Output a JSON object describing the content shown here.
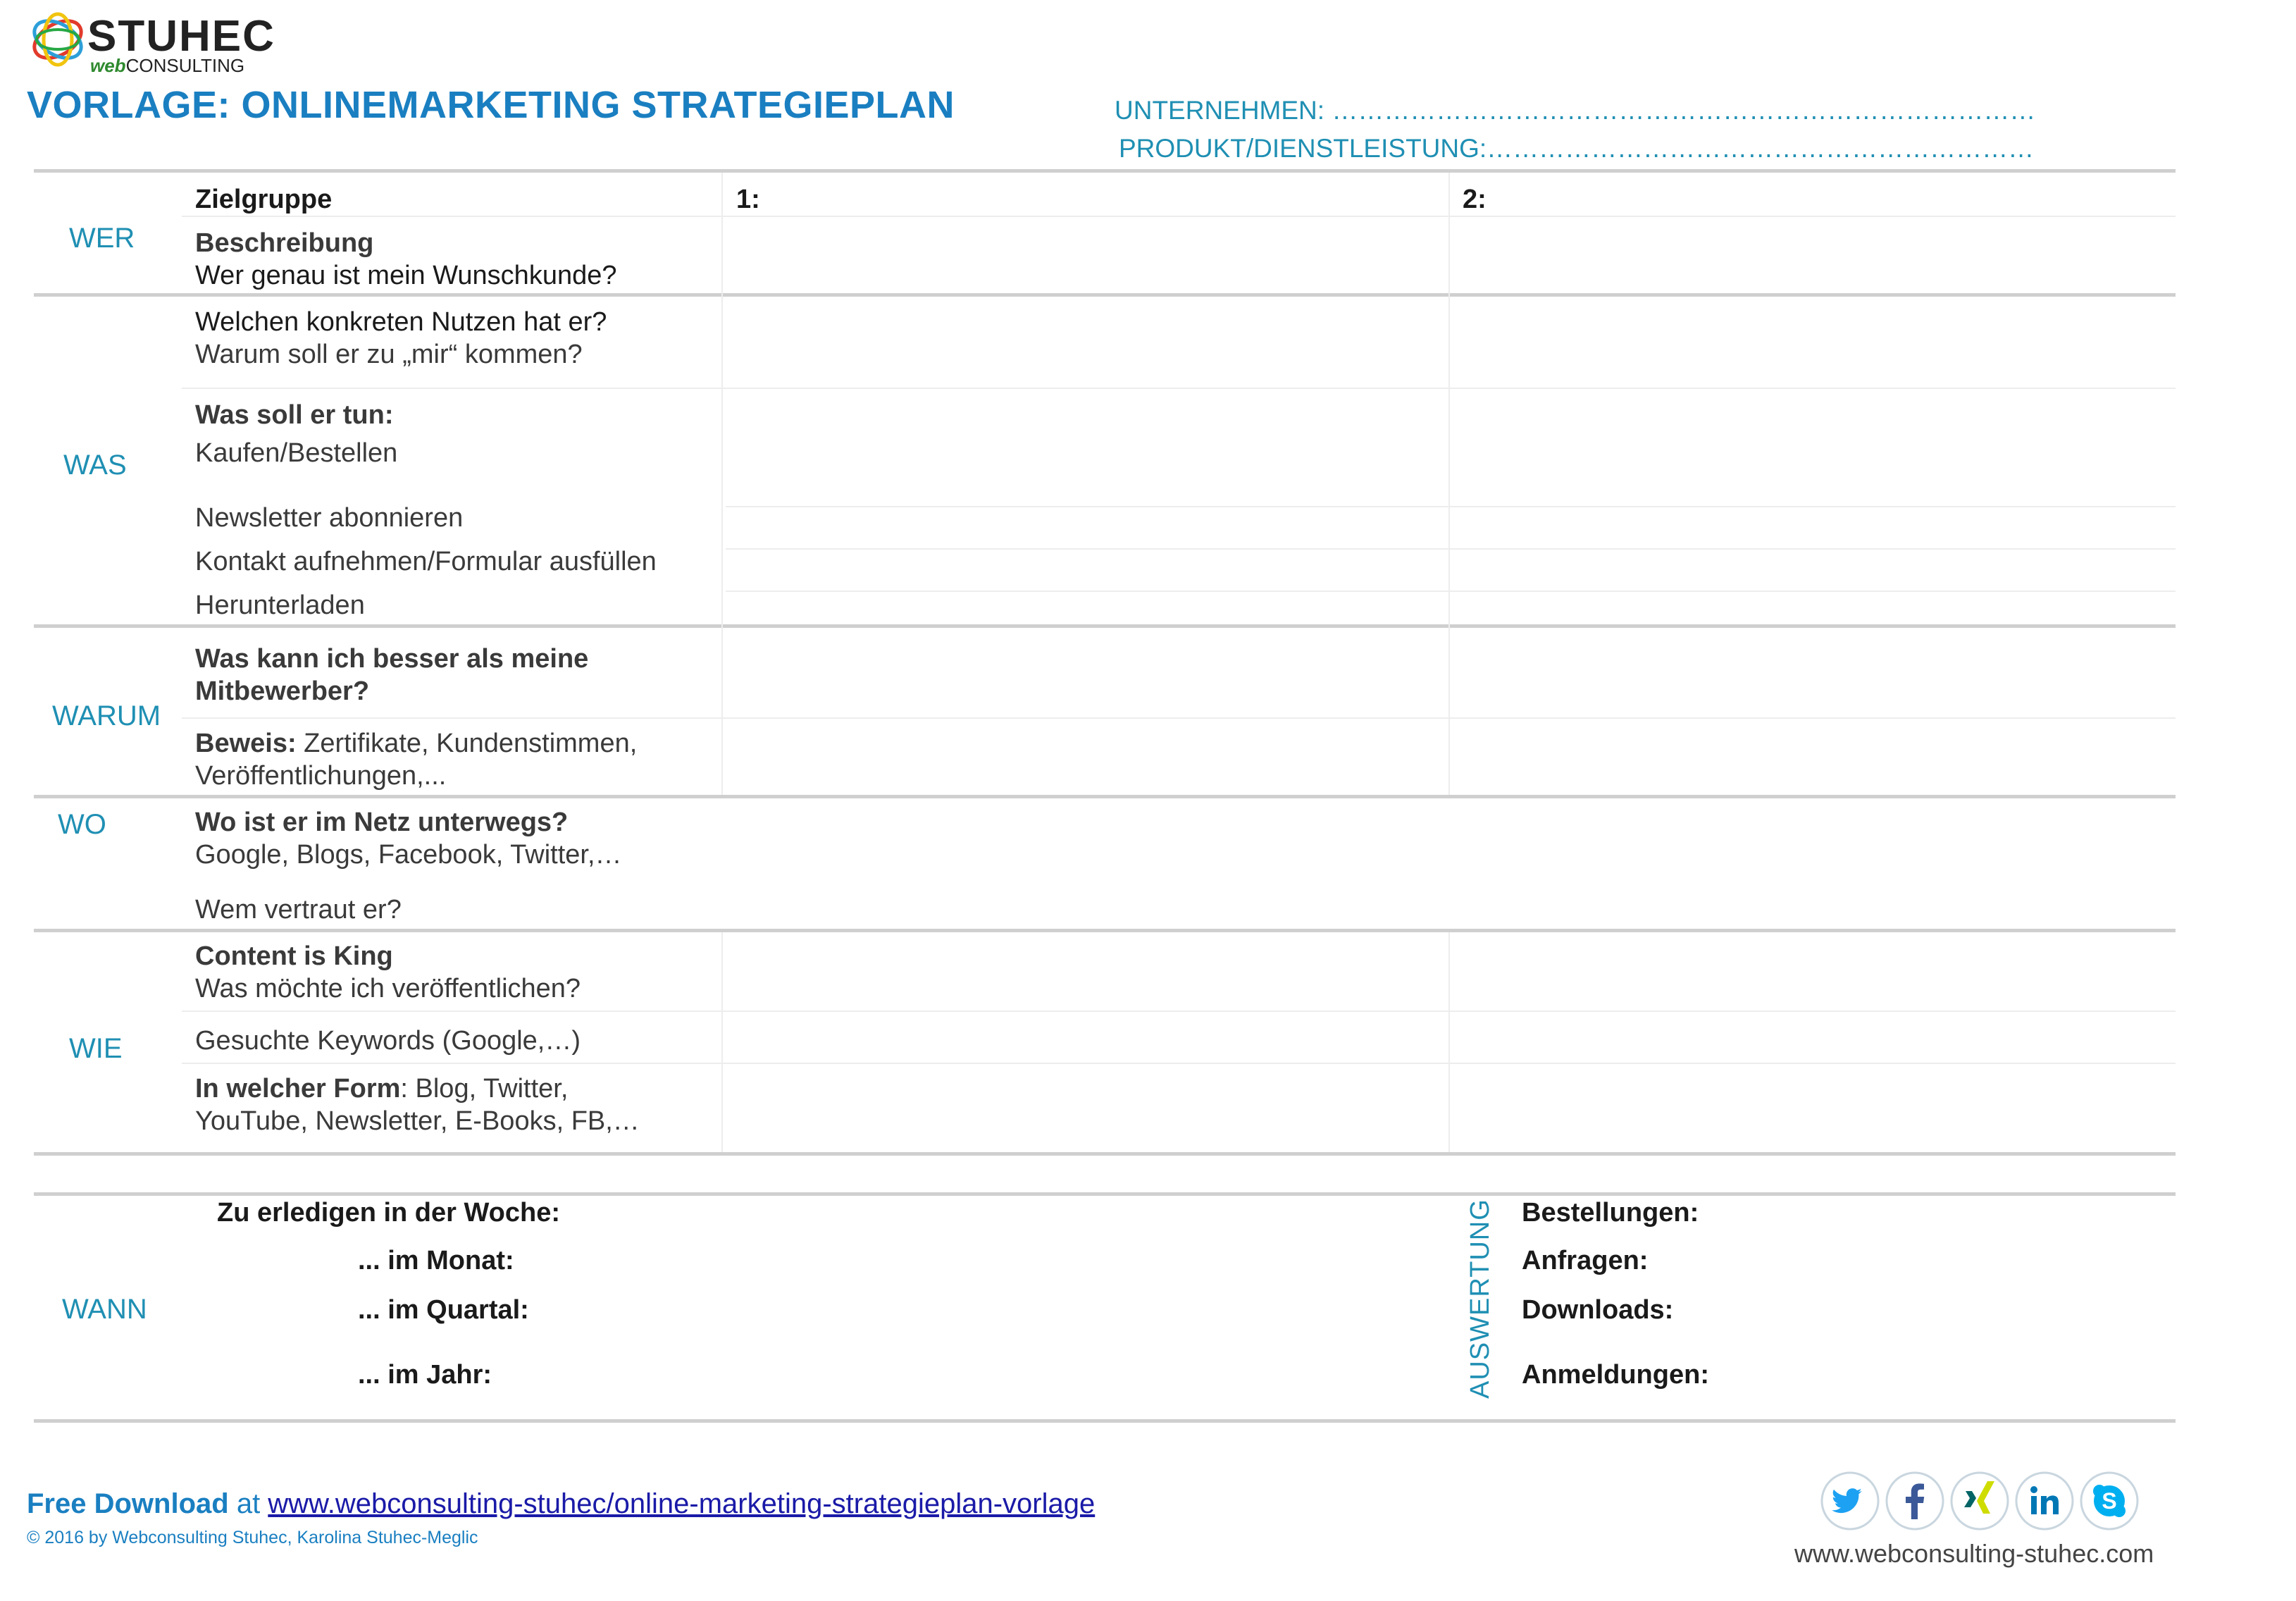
{
  "header": {
    "logo_main": "STUHEC",
    "logo_web": "web",
    "logo_consulting": "CONSULTING",
    "title": "VORLAGE: ONLINEMARKETING STRATEGIEPLAN",
    "unternehmen": "UNTERNEHMEN: ………………………………………………………………………",
    "produkt": "PRODUKT/DIENSTLEISTUNG:………………………………………………………"
  },
  "columns": {
    "col1": "1:",
    "col2": "2:"
  },
  "sections": {
    "wer": "WER",
    "was": "WAS",
    "warum": "WARUM",
    "wo": "WO",
    "wie": "WIE",
    "wann": "WANN"
  },
  "rows": {
    "zielgruppe": "Zielgruppe",
    "beschreibung": "Beschreibung",
    "wunschkunde": "Wer genau ist mein Wunschkunde?",
    "nutzen": "Welchen konkreten Nutzen hat er?",
    "warum_mir": "Warum soll er zu „mir“ kommen?",
    "was_tun": "Was soll er tun:",
    "kaufen": "Kaufen/Bestellen",
    "newsletter": "Newsletter abonnieren",
    "kontakt": "Kontakt aufnehmen/Formular ausfüllen",
    "herunterladen": "Herunterladen",
    "besser_1": "Was kann ich besser als meine",
    "besser_2": "Mitbewerber?",
    "beweis_label": "Beweis:",
    "beweis_text": " Zertifikate, Kundenstimmen,",
    "beweis_2": "Veröffentlichungen,...",
    "netz": "Wo ist er im Netz unterwegs?",
    "netz_list": "Google, Blogs, Facebook, Twitter,…",
    "vertraut": "Wem vertraut er?",
    "content_king": "Content is King",
    "veroeffentlichen": "Was möchte ich veröffentlichen?",
    "keywords": "Gesuchte Keywords (Google,…)",
    "form_label": "In welcher Form",
    "form_text": ": Blog, Twitter,",
    "form_2": "YouTube, Newsletter, E-Books, FB,…"
  },
  "wann": {
    "woche": "Zu erledigen in der Woche:",
    "monat": "... im Monat:",
    "quartal": "... im Quartal:",
    "jahr": "... im Jahr:",
    "auswertung": "AUSWERTUNG",
    "bestellungen": "Bestellungen:",
    "anfragen": "Anfragen:",
    "downloads": "Downloads:",
    "anmeldungen": "Anmeldungen:"
  },
  "footer": {
    "free_download": "Free Download",
    "at": " at ",
    "link": "www.webconsulting-stuhec/online-marketing-strategieplan-vorlage",
    "copyright": "© 2016 by Webconsulting Stuhec, Karolina Stuhec-Meglic",
    "website": "www.webconsulting-stuhec.com",
    "social_icons": [
      "twitter-icon",
      "facebook-icon",
      "xing-icon",
      "linkedin-icon",
      "skype-icon"
    ]
  },
  "colors": {
    "title_blue": "#1a7fc1",
    "section_teal": "#1f8fb3",
    "rule_gray": "#cfcfcf"
  }
}
